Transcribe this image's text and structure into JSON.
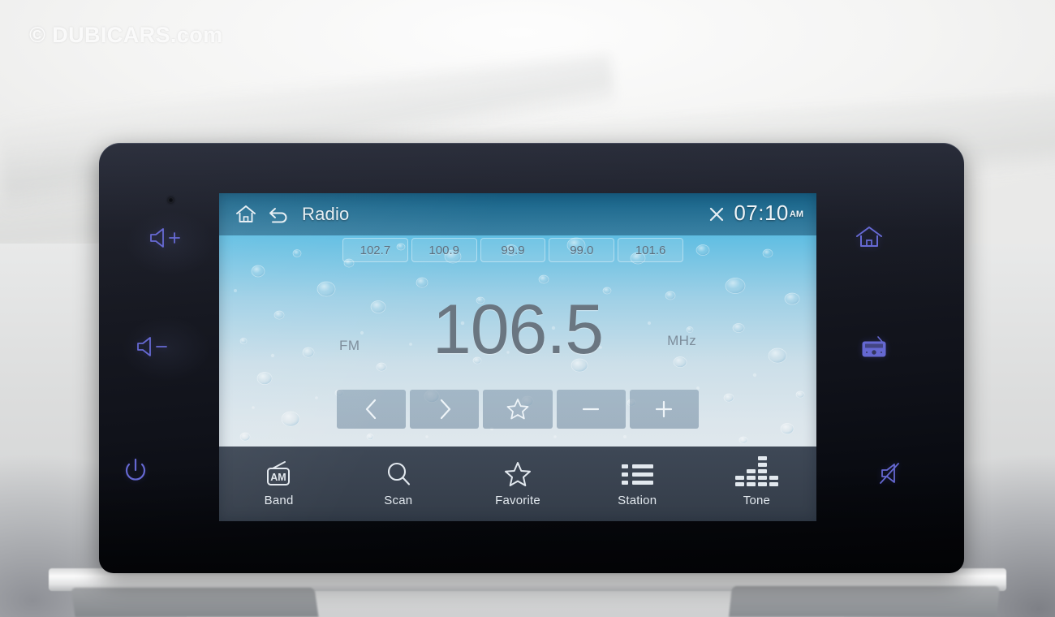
{
  "watermark": {
    "text": "© DUBICARS.com"
  },
  "screen": {
    "titlebar": {
      "home_icon": "home-icon",
      "back_icon": "back-arrow-icon",
      "title": "Radio",
      "close_icon": "close-x-icon",
      "clock": "07:10",
      "meridiem": "AM"
    },
    "presets": [
      {
        "label": "102.7"
      },
      {
        "label": "100.9"
      },
      {
        "label": "99.9"
      },
      {
        "label": "99.0"
      },
      {
        "label": "101.6"
      }
    ],
    "tuner": {
      "band": "FM",
      "frequency": "106.5",
      "unit": "MHz"
    },
    "transport": [
      {
        "name": "previous-station-button",
        "icon": "chevron-left-icon",
        "glyph": "‹"
      },
      {
        "name": "next-station-button",
        "icon": "chevron-right-icon",
        "glyph": "›"
      },
      {
        "name": "add-favorite-button",
        "icon": "star-icon",
        "glyph": "☆"
      },
      {
        "name": "tune-down-button",
        "icon": "minus-icon",
        "glyph": "−"
      },
      {
        "name": "tune-up-button",
        "icon": "plus-icon",
        "glyph": "+"
      }
    ],
    "navbar": [
      {
        "label": "Band",
        "icon": "radio-band-am-icon",
        "badge": "AM"
      },
      {
        "label": "Scan",
        "icon": "search-icon"
      },
      {
        "label": "Favorite",
        "icon": "star-icon"
      },
      {
        "label": "Station",
        "icon": "list-icon"
      },
      {
        "label": "Tone",
        "icon": "equalizer-icon"
      }
    ],
    "colors": {
      "navbar_bg": "#39424f",
      "titlebar_bg": "#164868",
      "screen_top": "#1fa4d8",
      "screen_bottom": "#e2e9ee",
      "freq_text": "#6a7681",
      "nav_label": "#e2e8ee"
    }
  },
  "hardware": {
    "left_buttons": [
      {
        "label": "Volume Up",
        "icon": "volume-up-icon"
      },
      {
        "label": "Volume Down",
        "icon": "volume-down-icon"
      },
      {
        "label": "Power",
        "icon": "power-icon"
      }
    ],
    "right_buttons": [
      {
        "label": "Home",
        "icon": "home-icon"
      },
      {
        "label": "Radio",
        "icon": "radio-icon"
      },
      {
        "label": "Mute",
        "icon": "mute-icon"
      }
    ],
    "accent_color": "#6d70e2"
  }
}
